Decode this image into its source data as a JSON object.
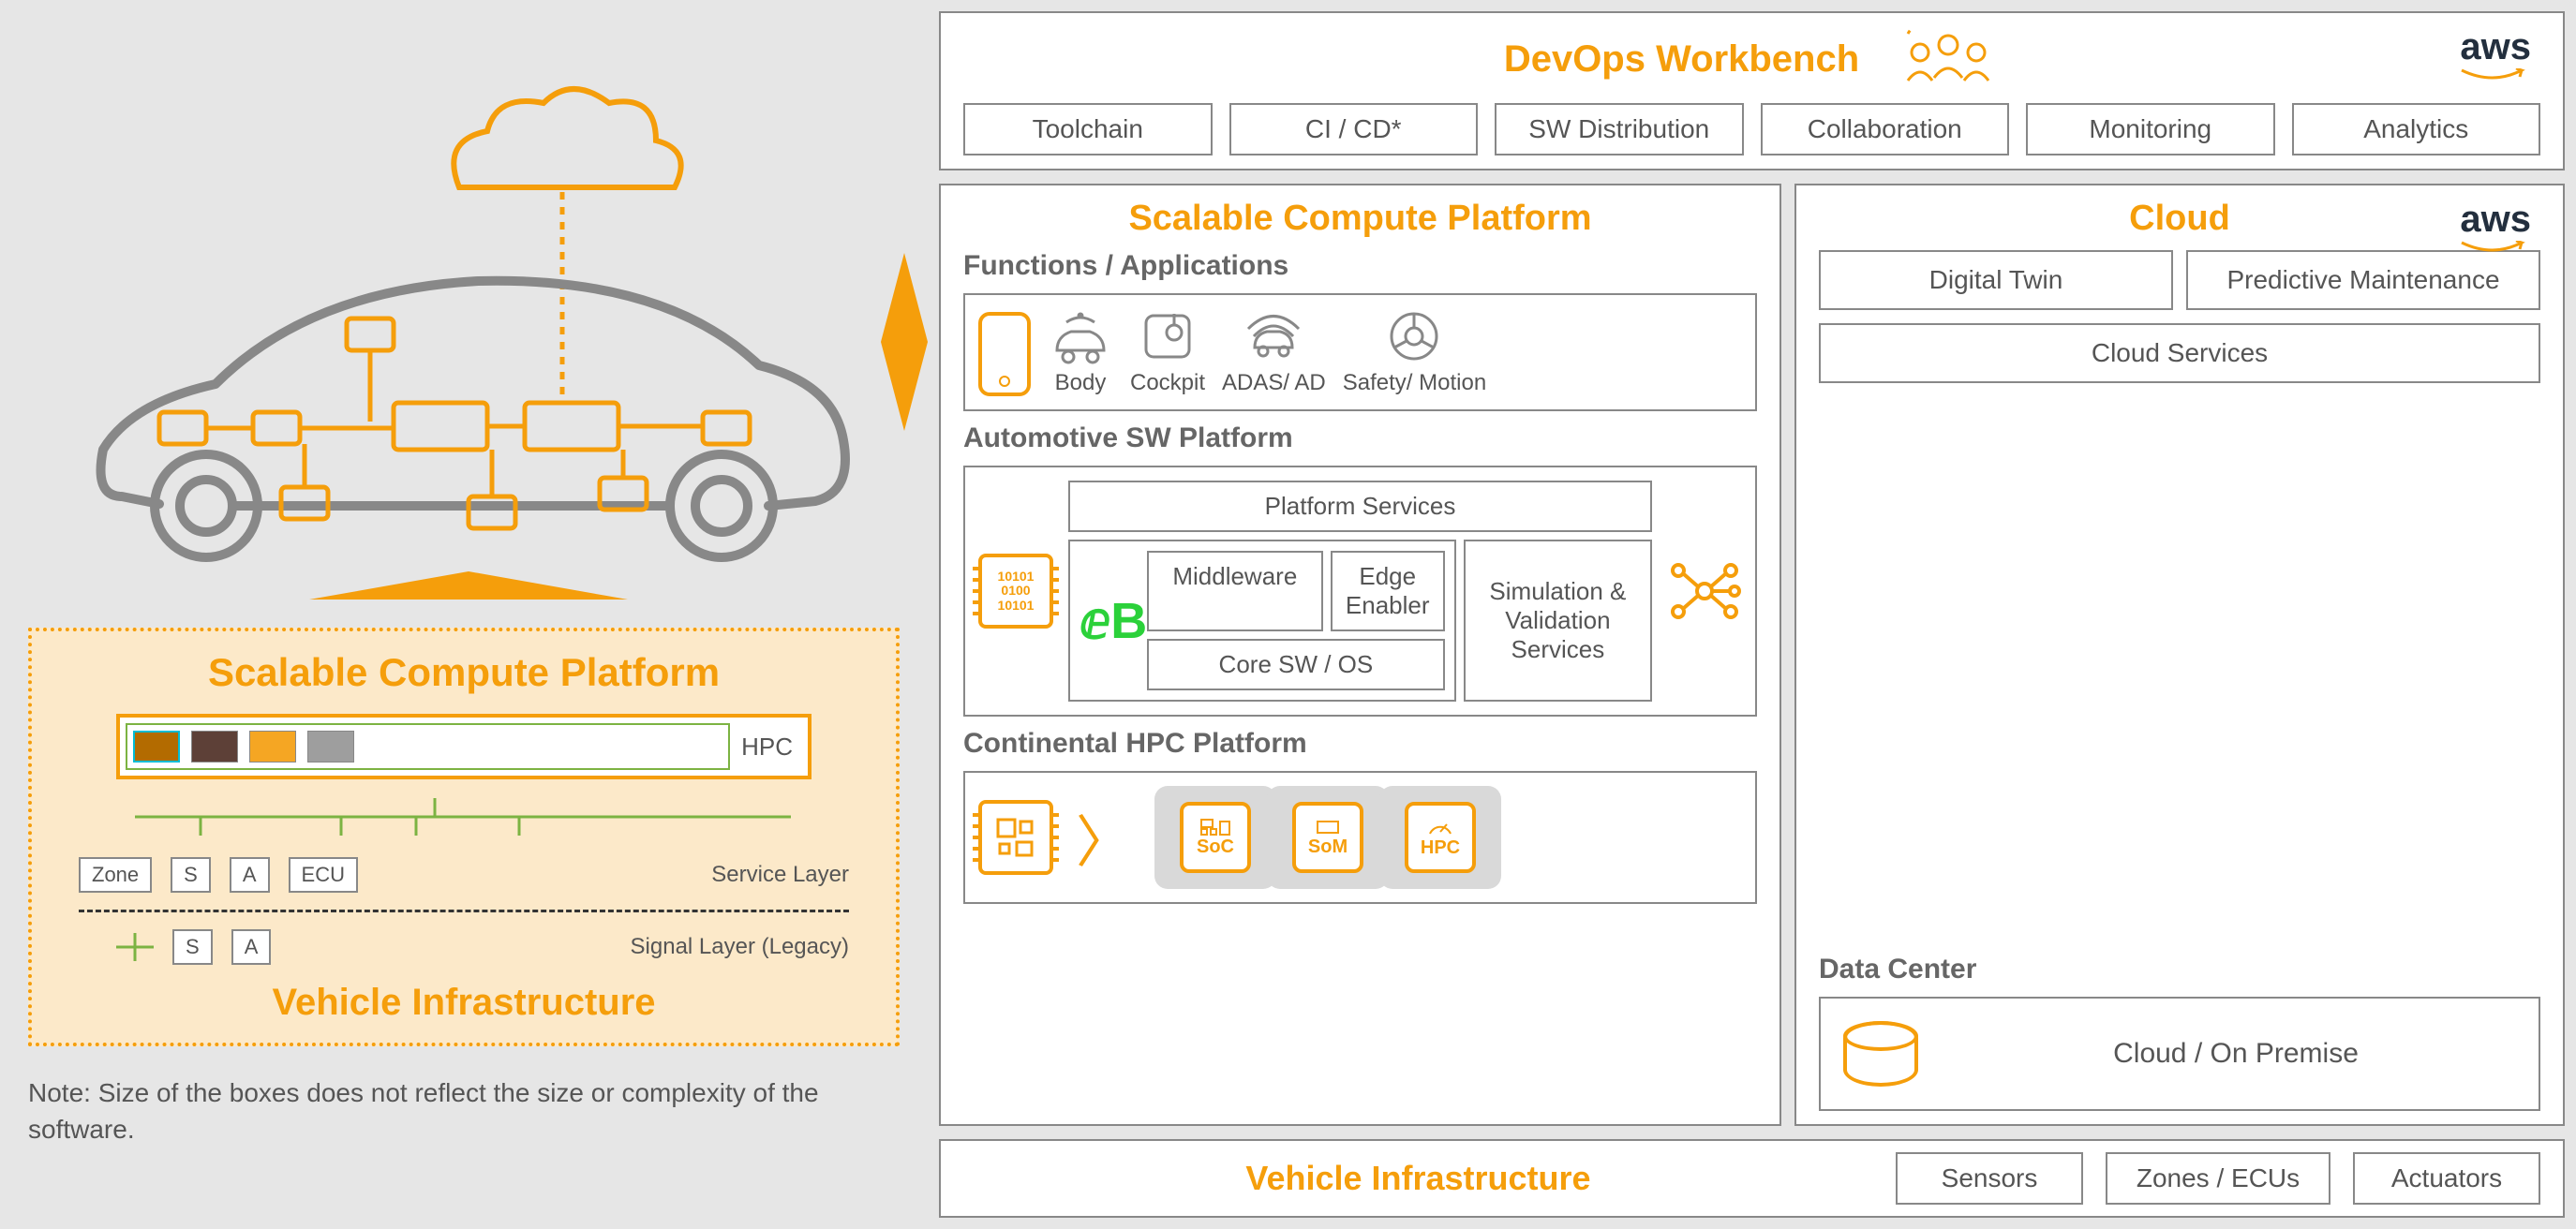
{
  "left": {
    "scp_title": "Scalable Compute Platform",
    "hpc_label": "HPC",
    "zone": "Zone",
    "s": "S",
    "a": "A",
    "ecu": "ECU",
    "service_layer": "Service Layer",
    "signal_layer": "Signal Layer (Legacy)",
    "vi_title": "Vehicle Infrastructure",
    "note": "Note: Size of the boxes does not reflect the size or complexity of the software."
  },
  "devops": {
    "title": "DevOps Workbench",
    "aws": "aws",
    "items": [
      "Toolchain",
      "CI / CD*",
      "SW Distribution",
      "Collaboration",
      "Monitoring",
      "Analytics"
    ]
  },
  "scp": {
    "title": "Scalable Compute Platform",
    "func_header": "Functions / Applications",
    "funcs": [
      "Body",
      "Cockpit",
      "ADAS/ AD",
      "Safety/ Motion"
    ],
    "asw_header": "Automotive SW Platform",
    "platform_services": "Platform Services",
    "middleware": "Middleware",
    "edge": "Edge Enabler",
    "core": "Core SW / OS",
    "sim": "Simulation & Validation Services",
    "chip_text": "10101 0100 10101",
    "chp_header": "Continental HPC Platform",
    "soc": "SoC",
    "som": "SoM",
    "hpc": "HPC"
  },
  "cloud": {
    "title": "Cloud",
    "aws": "aws",
    "items": [
      "Digital Twin",
      "Predictive Maintenance",
      "Cloud Services"
    ],
    "dc_header": "Data Center",
    "dc_item": "Cloud / On Premise"
  },
  "bottom": {
    "vi": "Vehicle Infrastructure",
    "items": [
      "Sensors",
      "Zones / ECUs",
      "Actuators"
    ]
  }
}
